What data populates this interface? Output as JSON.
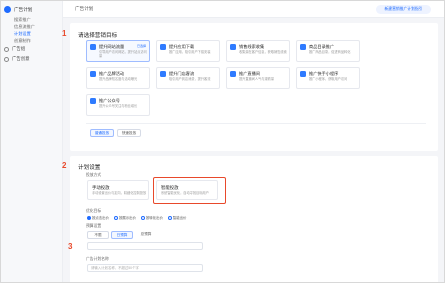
{
  "sidebar": {
    "brand": "广告计划",
    "items": [
      {
        "label": "搜索推广"
      },
      {
        "label": "信息流推广"
      },
      {
        "label": "计划设置"
      },
      {
        "label": "创意制作"
      }
    ],
    "groups": [
      {
        "label": "广告组"
      },
      {
        "label": "广告创意"
      }
    ]
  },
  "topbar": {
    "title": "广告计划",
    "action_label": "新建营销推广计划指引"
  },
  "section1": {
    "number": "1",
    "title": "请选择营销目标",
    "tiles": [
      {
        "name": "提升网站流量",
        "desc": "引导用户访问网站，提升站点访问量",
        "tag": "已选择"
      },
      {
        "name": "提升应用下载",
        "desc": "推广应用，吸引用户下载安装"
      },
      {
        "name": "销售线索收集",
        "desc": "收集潜在客户信息，获取销售线索"
      },
      {
        "name": "商品目录推广",
        "desc": "推广商品目录，促进商品转化"
      },
      {
        "name": "推广品牌活动",
        "desc": "提升品牌知名度与活动曝光"
      },
      {
        "name": "提升门店客流",
        "desc": "吸引用户到店消费，提升客流"
      },
      {
        "name": "推广直播间",
        "desc": "提升直播间人气与观看量"
      },
      {
        "name": "推广快手小程序",
        "desc": "推广小程序，获取用户访问"
      },
      {
        "name": "推广公众号",
        "desc": "提升公众号关注与粉丝增长"
      }
    ],
    "buttons": [
      {
        "label": "普通投放"
      },
      {
        "label": "快速投放"
      }
    ]
  },
  "section2": {
    "number": "2",
    "title": "计划设置",
    "mode_label": "投放方式",
    "modes": [
      {
        "name": "手动投放",
        "desc": "手动设置出价与定向，精细化控制投放"
      },
      {
        "name": "智能投放",
        "desc": "系统智能优化，自动寻找目标用户"
      }
    ],
    "option_label": "优化目标",
    "options": [
      {
        "label": "按点击出价"
      },
      {
        "label": "按展示出价"
      },
      {
        "label": "按转化出价"
      },
      {
        "label": "智能出价"
      }
    ],
    "budget_label": "预算设置",
    "budget_buttons": [
      {
        "label": "不限"
      },
      {
        "label": "日预算"
      },
      {
        "label": "总预算"
      }
    ]
  },
  "section3": {
    "number": "3",
    "field_label": "广告计划名称",
    "field_placeholder": "请输入计划名称，不超过50个字"
  },
  "colors": {
    "accent": "#1e6bff",
    "annotation": "#e8492b"
  }
}
